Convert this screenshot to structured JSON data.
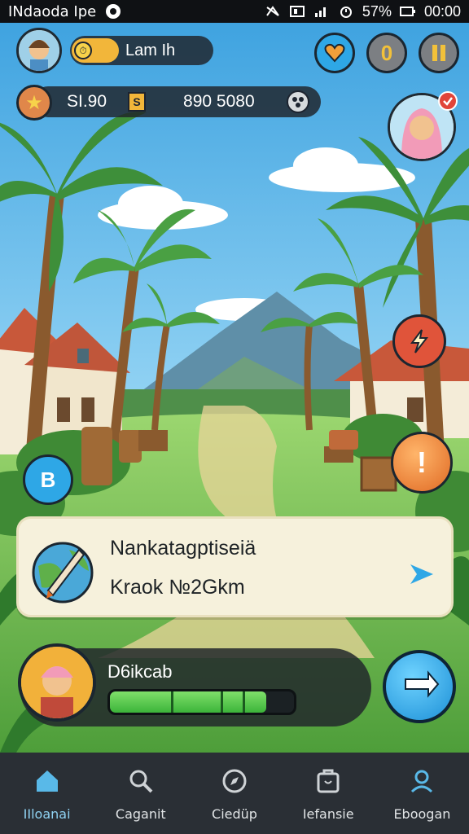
{
  "status_bar": {
    "carrier": "INdaoda Ipe",
    "battery": "57%",
    "time": "00:00",
    "icons": [
      "app-dot-icon",
      "no-signal-icon",
      "nfc-icon",
      "signal-bars-icon",
      "alarm-icon"
    ]
  },
  "hud": {
    "player_avatar": "player-avatar",
    "level_label": "Lam Ih",
    "coins": "SI.90",
    "currency_badge": "S",
    "gems": "890 5080",
    "icons": [
      "star-icon",
      "settings-icon",
      "heart-icon",
      "coin-icon",
      "pause-icon"
    ]
  },
  "side_buttons": {
    "notification_badge": "avatar-notification",
    "left_button_glyph": "B",
    "right_button_glyph": "!"
  },
  "quest": {
    "title": "Nankatagptiseiä",
    "subtitle": "Kraok №2Gkm",
    "icons": [
      "globe-quill-icon",
      "send-arrow-icon"
    ]
  },
  "player": {
    "name": "D6ikcab",
    "progress": 0.85
  },
  "nav": {
    "items": [
      {
        "label": "IIloanai",
        "icon": "home-icon",
        "active": true
      },
      {
        "label": "Caganit",
        "icon": "search-icon",
        "active": false
      },
      {
        "label": "Ciedüp",
        "icon": "compass-icon",
        "active": false
      },
      {
        "label": "Iefansie",
        "icon": "bag-icon",
        "active": false
      },
      {
        "label": "Eboogan",
        "icon": "profile-icon",
        "active": false
      }
    ]
  },
  "colors": {
    "sky": "#5fb3e6",
    "grass": "#7cc35a",
    "accent_blue": "#2ba3e6",
    "accent_orange": "#e8843a",
    "pill_bg": "#1e2228"
  }
}
